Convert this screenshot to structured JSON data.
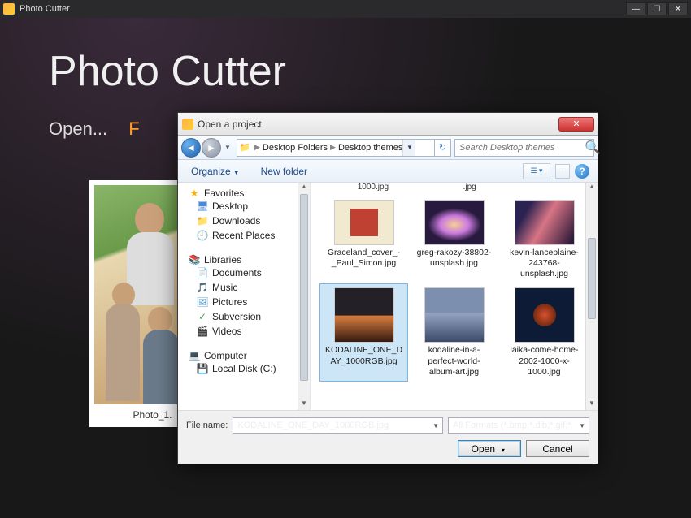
{
  "app": {
    "title": "Photo Cutter",
    "heading": "Photo Cutter",
    "open_label": "Open...",
    "open_file_partial": "F",
    "thumb_caption": "Photo_1."
  },
  "dialog": {
    "title": "Open a project",
    "breadcrumb": {
      "seg1": "Desktop Folders",
      "seg2": "Desktop themes"
    },
    "search_placeholder": "Search Desktop themes",
    "toolbar": {
      "organize": "Organize",
      "newfolder": "New folder"
    },
    "tree": {
      "favorites": "Favorites",
      "fav_items": [
        "Desktop",
        "Downloads",
        "Recent Places"
      ],
      "libraries": "Libraries",
      "lib_items": [
        "Documents",
        "Music",
        "Pictures",
        "Subversion",
        "Videos"
      ],
      "computer": "Computer",
      "comp_items": [
        "Local Disk (C:)"
      ]
    },
    "cutoff": {
      "a": "1000.jpg",
      "b": ".jpg"
    },
    "files": [
      {
        "name": "Graceland_cover_-_Paul_Simon.jpg"
      },
      {
        "name": "greg-rakozy-38802-unsplash.jpg"
      },
      {
        "name": "kevin-lanceplaine-243768-unsplash.jpg"
      },
      {
        "name": "KODALINE_ONE_DAY_1000RGB.jpg"
      },
      {
        "name": "kodaline-in-a-perfect-world-album-art.jpg"
      },
      {
        "name": "laika-come-home-2002-1000-x-1000.jpg"
      }
    ],
    "filename_label": "File name:",
    "filename_value": "KODALINE_ONE_DAY_1000RGB.jpg",
    "filter": "All Formats (*.bmp;*.dib;*.gif;*.",
    "buttons": {
      "open": "Open",
      "cancel": "Cancel"
    }
  }
}
